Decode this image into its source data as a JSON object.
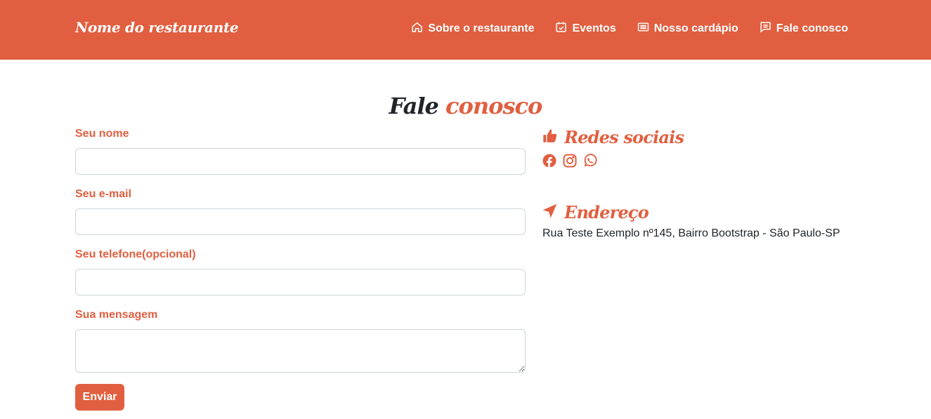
{
  "navbar": {
    "brand": "Nome do restaurante",
    "items": [
      {
        "label": "Sobre o restaurante",
        "icon": "home-icon"
      },
      {
        "label": "Eventos",
        "icon": "calendar-icon"
      },
      {
        "label": "Nosso cardápio",
        "icon": "menu-card-icon"
      },
      {
        "label": "Fale conosco",
        "icon": "chat-icon"
      }
    ]
  },
  "page_title": {
    "dark": "Fale ",
    "accent": "conosco"
  },
  "form": {
    "fields": [
      {
        "label": "Seu nome",
        "value": ""
      },
      {
        "label": "Seu e-mail",
        "value": ""
      },
      {
        "label": "Seu telefone(opcional)",
        "value": ""
      },
      {
        "label": "Sua mensagem",
        "value": ""
      }
    ],
    "submit_label": "Enviar"
  },
  "sidebar": {
    "social_heading": "Redes sociais",
    "social_icons": [
      "facebook-icon",
      "instagram-icon",
      "whatsapp-icon"
    ],
    "address_heading": "Endereço",
    "address": "Rua Teste Exemplo nº145, Bairro Bootstrap - São Paulo-SP"
  },
  "colors": {
    "accent": "#e15f40",
    "text": "#212529"
  }
}
